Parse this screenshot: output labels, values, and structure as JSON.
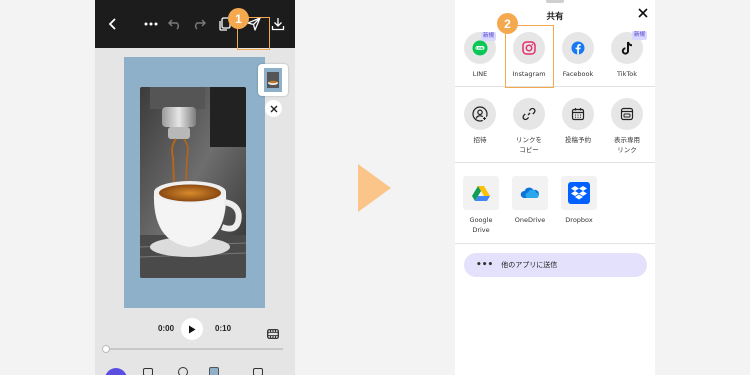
{
  "steps": {
    "step1": "1",
    "step2": "2"
  },
  "editor": {
    "time_current": "0:00",
    "time_total": "0:10"
  },
  "share_sheet": {
    "title": "共有",
    "apps_row1": [
      {
        "label": "LINE",
        "icon": "line-icon",
        "color": "#06c755",
        "badge": ""
      },
      {
        "label": "Instagram",
        "icon": "instagram-icon",
        "color": "#e1306c",
        "badge": ""
      },
      {
        "label": "Facebook",
        "icon": "facebook-icon",
        "color": "#1877f2",
        "badge": ""
      },
      {
        "label": "TikTok",
        "icon": "tiktok-icon",
        "color": "#111111",
        "badge": "新規"
      }
    ],
    "line_badge": "新規",
    "actions_row2": [
      {
        "label": "招待",
        "icon": "invite-user-icon"
      },
      {
        "label": "リンクを\nコピー",
        "icon": "link-icon"
      },
      {
        "label": "投稿予約",
        "icon": "calendar-icon"
      },
      {
        "label": "表示専用\nリンク",
        "icon": "view-only-link-icon"
      }
    ],
    "storage_row3": [
      {
        "label": "Google\nDrive",
        "icon": "google-drive-icon"
      },
      {
        "label": "OneDrive",
        "icon": "onedrive-icon"
      },
      {
        "label": "Dropbox",
        "icon": "dropbox-icon"
      }
    ],
    "other_apps": {
      "dots": "•••",
      "label": "他のアプリに送信"
    }
  },
  "colors": {
    "accent_orange": "#f5a94e",
    "arrow": "#fbc58a",
    "canvas_bg": "#8eb0c9",
    "badge_bg": "#d9d6ff",
    "other_apps_bg": "#e3e1fb"
  }
}
